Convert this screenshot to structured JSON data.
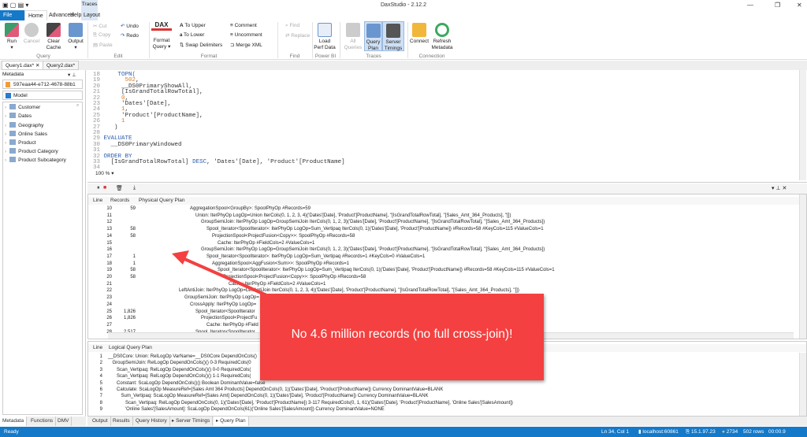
{
  "app": {
    "title": "DaxStudio - 2.12.2",
    "context_tab": "Traces"
  },
  "menu_tabs": [
    "File",
    "Home",
    "Advanced",
    "Help",
    "Layout"
  ],
  "ribbon": {
    "query": {
      "label": "Query",
      "run": "Run",
      "cancel": "Cancel",
      "clear_cache": "Clear Cache",
      "output": "Output"
    },
    "edit": {
      "label": "Edit",
      "cut": "Cut",
      "copy": "Copy",
      "paste": "Paste",
      "undo": "Undo",
      "redo": "Redo"
    },
    "format": {
      "label": "Format",
      "format_query": "Format Query",
      "dax_logo": "DAX",
      "to_upper": "To Upper",
      "to_lower": "To Lower",
      "swap": "Swap Delimiters",
      "comment": "Comment",
      "uncomment": "Uncomment",
      "merge_xml": "Merge XML"
    },
    "find": {
      "label": "Find",
      "find": "Find",
      "replace": "Replace"
    },
    "powerbi": {
      "label": "Power BI",
      "load_perf": "Load Perf Data"
    },
    "traces": {
      "label": "Traces",
      "all_queries": "All Queries",
      "query_plan": "Query Plan",
      "server_timings": "Server Timings"
    },
    "connection": {
      "label": "Connection",
      "connect": "Connect",
      "refresh": "Refresh Metadata"
    }
  },
  "doc_tabs": [
    {
      "label": "Query1.dax*",
      "close": "✕"
    },
    {
      "label": "Query2.dax*"
    }
  ],
  "metadata": {
    "title": "Metadata",
    "connection": "597eaa44-e712-4678-88b1",
    "model": "Model",
    "tables": [
      "Customer",
      "Dates",
      "Geography",
      "Online Sales",
      "Product",
      "Product Category",
      "Product Subcategory"
    ],
    "tabs": [
      "Metadata",
      "Functions",
      "DMV"
    ]
  },
  "editor": {
    "zoom": "100 %",
    "lines": [
      {
        "n": "18",
        "t": [
          [
            "    ",
            ""
          ],
          [
            "TOPN(",
            "kw"
          ]
        ]
      },
      {
        "n": "19",
        "t": [
          [
            "      ",
            ""
          ],
          [
            "502",
            "num"
          ],
          [
            ",",
            "id"
          ]
        ]
      },
      {
        "n": "20",
        "t": [
          [
            "     ",
            ""
          ],
          [
            "__DS0PrimaryShowAll,",
            "id"
          ]
        ]
      },
      {
        "n": "21",
        "t": [
          [
            "     ",
            ""
          ],
          [
            "[IsGrandTotalRowTotal],",
            "id"
          ]
        ]
      },
      {
        "n": "22",
        "t": [
          [
            "     ",
            ""
          ],
          [
            "0",
            "num"
          ],
          [
            ",",
            "id"
          ]
        ]
      },
      {
        "n": "23",
        "t": [
          [
            "     ",
            ""
          ],
          [
            "'Dates'[Date],",
            "id"
          ]
        ]
      },
      {
        "n": "24",
        "t": [
          [
            "     ",
            ""
          ],
          [
            "1",
            "num"
          ],
          [
            ",",
            "id"
          ]
        ]
      },
      {
        "n": "25",
        "t": [
          [
            "     ",
            ""
          ],
          [
            "'Product'[ProductName],",
            "id"
          ]
        ]
      },
      {
        "n": "26",
        "t": [
          [
            "     ",
            ""
          ],
          [
            "1",
            "num"
          ]
        ]
      },
      {
        "n": "27",
        "t": [
          [
            "   ",
            ""
          ],
          [
            ")",
            "id"
          ]
        ]
      },
      {
        "n": "28",
        "t": []
      },
      {
        "n": "29",
        "t": [
          [
            "EVALUATE",
            "kw"
          ]
        ]
      },
      {
        "n": "30",
        "t": [
          [
            "  ",
            ""
          ],
          [
            "__DS0PrimaryWindowed",
            "id"
          ]
        ]
      },
      {
        "n": "31",
        "t": []
      },
      {
        "n": "32",
        "t": [
          [
            "ORDER BY",
            "kw"
          ]
        ]
      },
      {
        "n": "33",
        "t": [
          [
            "  ",
            ""
          ],
          [
            "[IsGrandTotalRowTotal] ",
            "id"
          ],
          [
            "DESC",
            "kw"
          ],
          [
            ", 'Dates'[Date], 'Product'[ProductName]",
            "id"
          ]
        ]
      },
      {
        "n": "34",
        "t": []
      }
    ]
  },
  "physical": {
    "headers": [
      "Line",
      "Records",
      "Physical Query Plan"
    ],
    "rows": [
      {
        "line": "10",
        "records": "59",
        "level": 3,
        "text": "AggregationSpool<GroupBy>: SpoolPhyOp #Records=59"
      },
      {
        "line": "11",
        "records": "",
        "level": 4,
        "text": "Union: IterPhyOp LogOp=Union IterCols(0, 1, 2, 3, 4)('Dates'[Date], 'Product'[ProductName], ''[IsGrandTotalRowTotal], ''[Sales_Amt_364_Products], ''[])"
      },
      {
        "line": "12",
        "records": "",
        "level": 5,
        "text": "GroupSemiJoin: IterPhyOp LogOp=GroupSemiJoin IterCols(0, 1, 2, 3)('Dates'[Date], 'Product'[ProductName], ''[IsGrandTotalRowTotal], ''[Sales_Amt_364_Products])"
      },
      {
        "line": "13",
        "records": "58",
        "level": 6,
        "text": "Spool_Iterator<SpoolIterator>: IterPhyOp LogOp=Sum_Vertipaq IterCols(0, 1)('Dates'[Date], 'Product'[ProductName]) #Records=58 #KeyCols=115 #ValueCols=1"
      },
      {
        "line": "14",
        "records": "58",
        "level": 7,
        "text": "ProjectionSpool<ProjectFusion<Copy>>: SpoolPhyOp #Records=58"
      },
      {
        "line": "15",
        "records": "",
        "level": 8,
        "text": "Cache: IterPhyOp #FieldCols=2 #ValueCols=1"
      },
      {
        "line": "16",
        "records": "",
        "level": 5,
        "text": "GroupSemiJoin: IterPhyOp LogOp=GroupSemiJoin IterCols(0, 1, 2, 3)('Dates'[Date], 'Product'[ProductName], ''[IsGrandTotalRowTotal], ''[Sales_Amt_364_Products])"
      },
      {
        "line": "17",
        "records": "1",
        "level": 6,
        "text": "Spool_Iterator<SpoolIterator>: IterPhyOp LogOp=Sum_Vertipaq #Records=1 #KeyCols=0 #ValueCols=1"
      },
      {
        "line": "18",
        "records": "1",
        "level": 7,
        "text": "AggregationSpool<AggFusion<Sum>>: SpoolPhyOp #Records=1"
      },
      {
        "line": "19",
        "records": "58",
        "level": 8,
        "text": "Spool_Iterator<SpoolIterator>: IterPhyOp LogOp=Sum_Vertipaq IterCols(0, 1)('Dates'[Date], 'Product'[ProductName]) #Records=58 #KeyCols=115 #ValueCols=1"
      },
      {
        "line": "20",
        "records": "58",
        "level": 9,
        "text": "ProjectionSpool<ProjectFusion<Copy>>: SpoolPhyOp #Records=58"
      },
      {
        "line": "21",
        "records": "",
        "level": 10,
        "text": "Cache: IterPhyOp #FieldCols=2 #ValueCols=1"
      },
      {
        "line": "22",
        "records": "",
        "level": 1,
        "text": "LeftAntiJoin: IterPhyOp LogOp=LeftAntiJoin IterCols(0, 1, 2, 3, 4)('Dates'[Date], 'Product'[ProductName], ''[IsGrandTotalRowTotal], ''[Sales_Amt_364_Products], ''[])"
      },
      {
        "line": "23",
        "records": "",
        "level": 2,
        "text": "GroupSemiJoin: IterPhyOp LogOp="
      },
      {
        "line": "24",
        "records": "",
        "level": 3,
        "text": "CrossApply: IterPhyOp LogOp="
      },
      {
        "line": "25",
        "records": "1,826",
        "level": 4,
        "text": "Spool_Iterator<SpoolIterator"
      },
      {
        "line": "26",
        "records": "1,826",
        "level": 5,
        "text": "ProjectionSpool<ProjectFu"
      },
      {
        "line": "27",
        "records": "",
        "level": 6,
        "text": "Cache: IterPhyOp #Field"
      },
      {
        "line": "28",
        "records": "2,517",
        "level": 4,
        "text": "Spool_Iterator<SpoolIterator"
      }
    ]
  },
  "logical": {
    "headers": [
      "Line",
      "Logical Query Plan"
    ],
    "rows": [
      {
        "line": "1",
        "level": 0,
        "text": "__DS0Core: Union: RelLogOp VarName=__DS0Core DependOnCols()"
      },
      {
        "line": "2",
        "level": 1,
        "text": "GroupSemiJoin: RelLogOp DependOnCols()() 0-3 RequiredCols(0"
      },
      {
        "line": "3",
        "level": 2,
        "text": "Scan_Vertipaq: RelLogOp DependOnCols()() 0-0 RequiredCols("
      },
      {
        "line": "4",
        "level": 2,
        "text": "Scan_Vertipaq: RelLogOp DependOnCols()() 1-1 RequiredCols("
      },
      {
        "line": "5",
        "level": 2,
        "text": "Constant: ScaLogOp DependOnCols()() Boolean DominantValue=false"
      },
      {
        "line": "6",
        "level": 2,
        "text": "Calculate: ScaLogOp MeasureRef=[Sales Amt 364 Products] DependOnCols(0, 1)('Dates'[Date], 'Product'[ProductName]) Currency DominantValue=BLANK"
      },
      {
        "line": "7",
        "level": 3,
        "text": "Sum_Vertipaq: ScaLogOp MeasureRef=[Sales Amt] DependOnCols(0, 1)('Dates'[Date], 'Product'[ProductName]) Currency DominantValue=BLANK"
      },
      {
        "line": "8",
        "level": 4,
        "text": "Scan_Vertipaq: RelLogOp DependOnCols(0, 1)('Dates'[Date], 'Product'[ProductName]) 3-117 RequiredCols(0, 1, 61)('Dates'[Date], 'Product'[ProductName], 'Online Sales'[SalesAmount])"
      },
      {
        "line": "9",
        "level": 4,
        "text": "'Online Sales'[SalesAmount]: ScaLogOp DependOnCols(61)('Online Sales'[SalesAmount]) Currency DominantValue=NONE"
      }
    ]
  },
  "bottom_tabs": [
    "Output",
    "Results",
    "Query History",
    "Server Timings",
    "Query Plan"
  ],
  "callout": "No 4.6 million records (no full cross-join)!",
  "status": {
    "left": "Ready",
    "position": "Ln 34, Col 1",
    "server": "localhost:60861",
    "version": "15.1.97.23",
    "spid": "2734",
    "rows": "502 rows",
    "time": "00:00.9"
  },
  "colors": {
    "accent": "#1479c9",
    "callout": "#f44040",
    "keyword": "#2a5db0",
    "number": "#e07b24"
  }
}
